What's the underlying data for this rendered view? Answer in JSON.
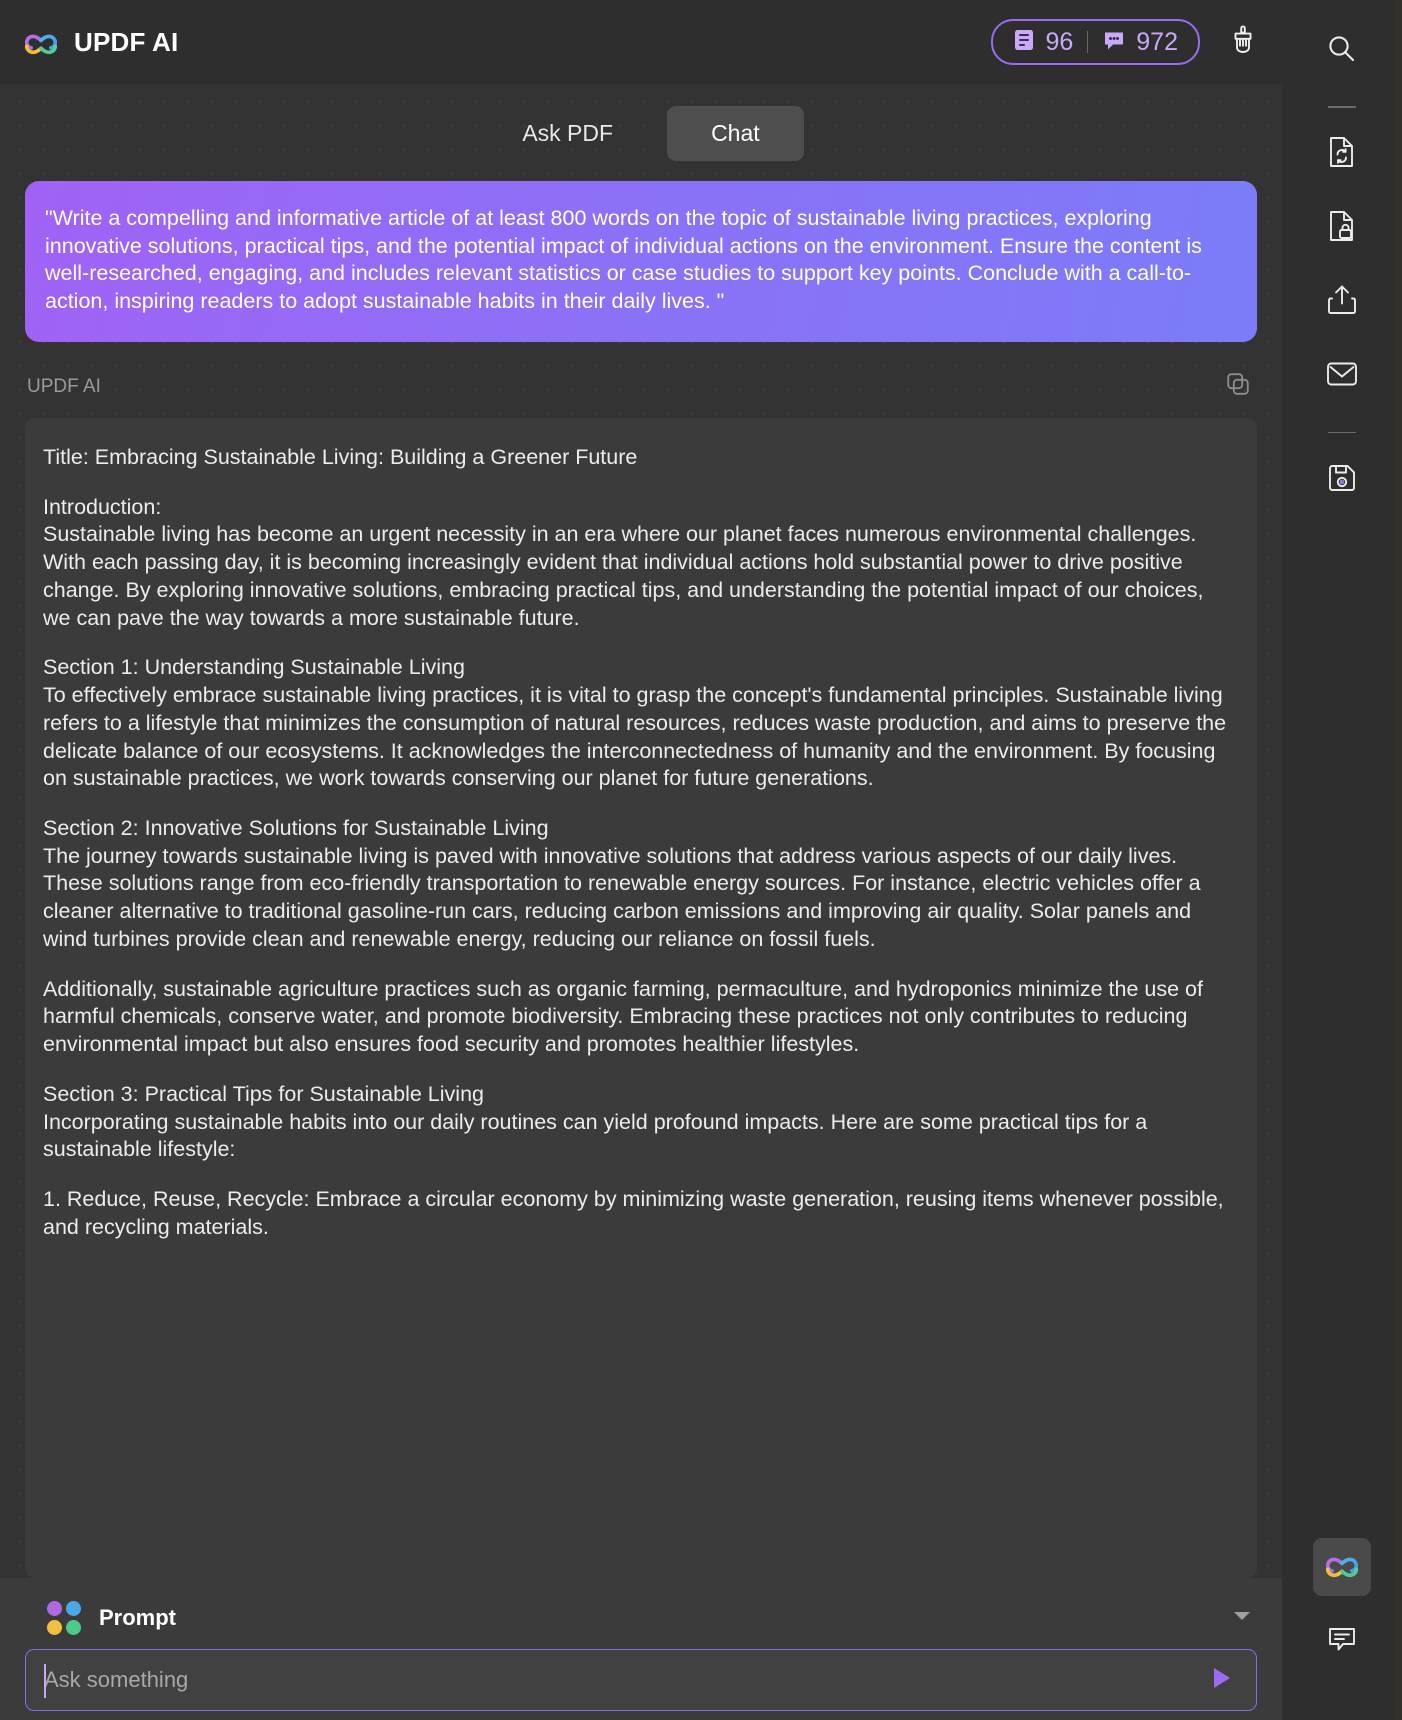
{
  "header": {
    "brand_name": "UPDF AI",
    "logo_icon": "updf-clover-logo",
    "pages_icon": "document-pages-icon",
    "pages_count": "96",
    "messages_icon": "chat-bubble-icon",
    "messages_count": "972",
    "clear_icon": "brush-icon"
  },
  "tabs": [
    {
      "label": "Ask PDF",
      "active": false
    },
    {
      "label": "Chat",
      "active": true
    }
  ],
  "conversation": {
    "user_prompt": "\"Write a compelling and informative article of at least 800 words on the topic of sustainable living practices, exploring innovative solutions, practical tips, and the potential impact of individual actions on the environment. Ensure the content is well-researched, engaging, and includes relevant statistics or case studies to support key points. Conclude with a call-to-action, inspiring readers to adopt sustainable habits in their daily lives. \"",
    "answer_author": "UPDF AI",
    "copy_icon": "copy-icon",
    "answer_paragraphs": [
      "Title: Embracing Sustainable Living: Building a Greener Future",
      "Introduction:\nSustainable living has become an urgent necessity in an era where our planet faces numerous environmental challenges. With each passing day, it is becoming increasingly evident that individual actions hold substantial power to drive positive change. By exploring innovative solutions, embracing practical tips, and understanding the potential impact of our choices, we can pave the way towards a more sustainable future.",
      "Section 1: Understanding Sustainable Living\nTo effectively embrace sustainable living practices, it is vital to grasp the concept's fundamental principles. Sustainable living refers to a lifestyle that minimizes the consumption of natural resources, reduces waste production, and aims to preserve the delicate balance of our ecosystems. It acknowledges the interconnectedness of humanity and the environment. By focusing on sustainable practices, we work towards conserving our planet for future generations.",
      "Section 2: Innovative Solutions for Sustainable Living\nThe journey towards sustainable living is paved with innovative solutions that address various aspects of our daily lives. These solutions range from eco-friendly transportation to renewable energy sources. For instance, electric vehicles offer a cleaner alternative to traditional gasoline-run cars, reducing carbon emissions and improving air quality. Solar panels and wind turbines provide clean and renewable energy, reducing our reliance on fossil fuels.",
      "Additionally, sustainable agriculture practices such as organic farming, permaculture, and hydroponics minimize the use of harmful chemicals, conserve water, and promote biodiversity. Embracing these practices not only contributes to reducing environmental impact but also ensures food security and promotes healthier lifestyles.",
      "Section 3: Practical Tips for Sustainable Living\nIncorporating sustainable habits into our daily routines can yield profound impacts. Here are some practical tips for a sustainable lifestyle:",
      "1. Reduce, Reuse, Recycle: Embrace a circular economy by minimizing waste generation, reusing items whenever possible, and recycling materials."
    ]
  },
  "composer": {
    "prompt_icon": "four-dots-icon",
    "prompt_label": "Prompt",
    "chevron_icon": "chevron-down-icon",
    "input_value": "",
    "input_placeholder": "Ask something",
    "send_icon": "send-icon"
  },
  "rail": {
    "top_items": [
      {
        "icon": "search-icon",
        "name": "search"
      },
      {
        "icon": "divider",
        "name": "divider-1"
      },
      {
        "icon": "convert-document-icon",
        "name": "convert-pdf"
      },
      {
        "icon": "protect-document-icon",
        "name": "protect-pdf"
      },
      {
        "icon": "share-icon",
        "name": "share"
      },
      {
        "icon": "email-icon",
        "name": "email"
      },
      {
        "icon": "divider",
        "name": "divider-2"
      },
      {
        "icon": "save-icon",
        "name": "save"
      }
    ],
    "bottom_items": [
      {
        "icon": "updf-clover-logo",
        "name": "updf-ai",
        "active": true
      },
      {
        "icon": "comment-icon",
        "name": "comment",
        "active": false
      }
    ]
  },
  "colors": {
    "accent_purple": "#9b6bf0",
    "badge_text": "#c9a9f7",
    "bubble_gradient_start": "#a062f5",
    "bubble_gradient_end": "#7b7cf8",
    "panel_bg": "#2e2e2e",
    "content_bg": "#333333",
    "card_bg": "#3b3b3b",
    "logo_purple": "#b06ae0",
    "logo_blue": "#4aa7e8",
    "logo_yellow": "#f2c040",
    "logo_green": "#4fc98a"
  }
}
